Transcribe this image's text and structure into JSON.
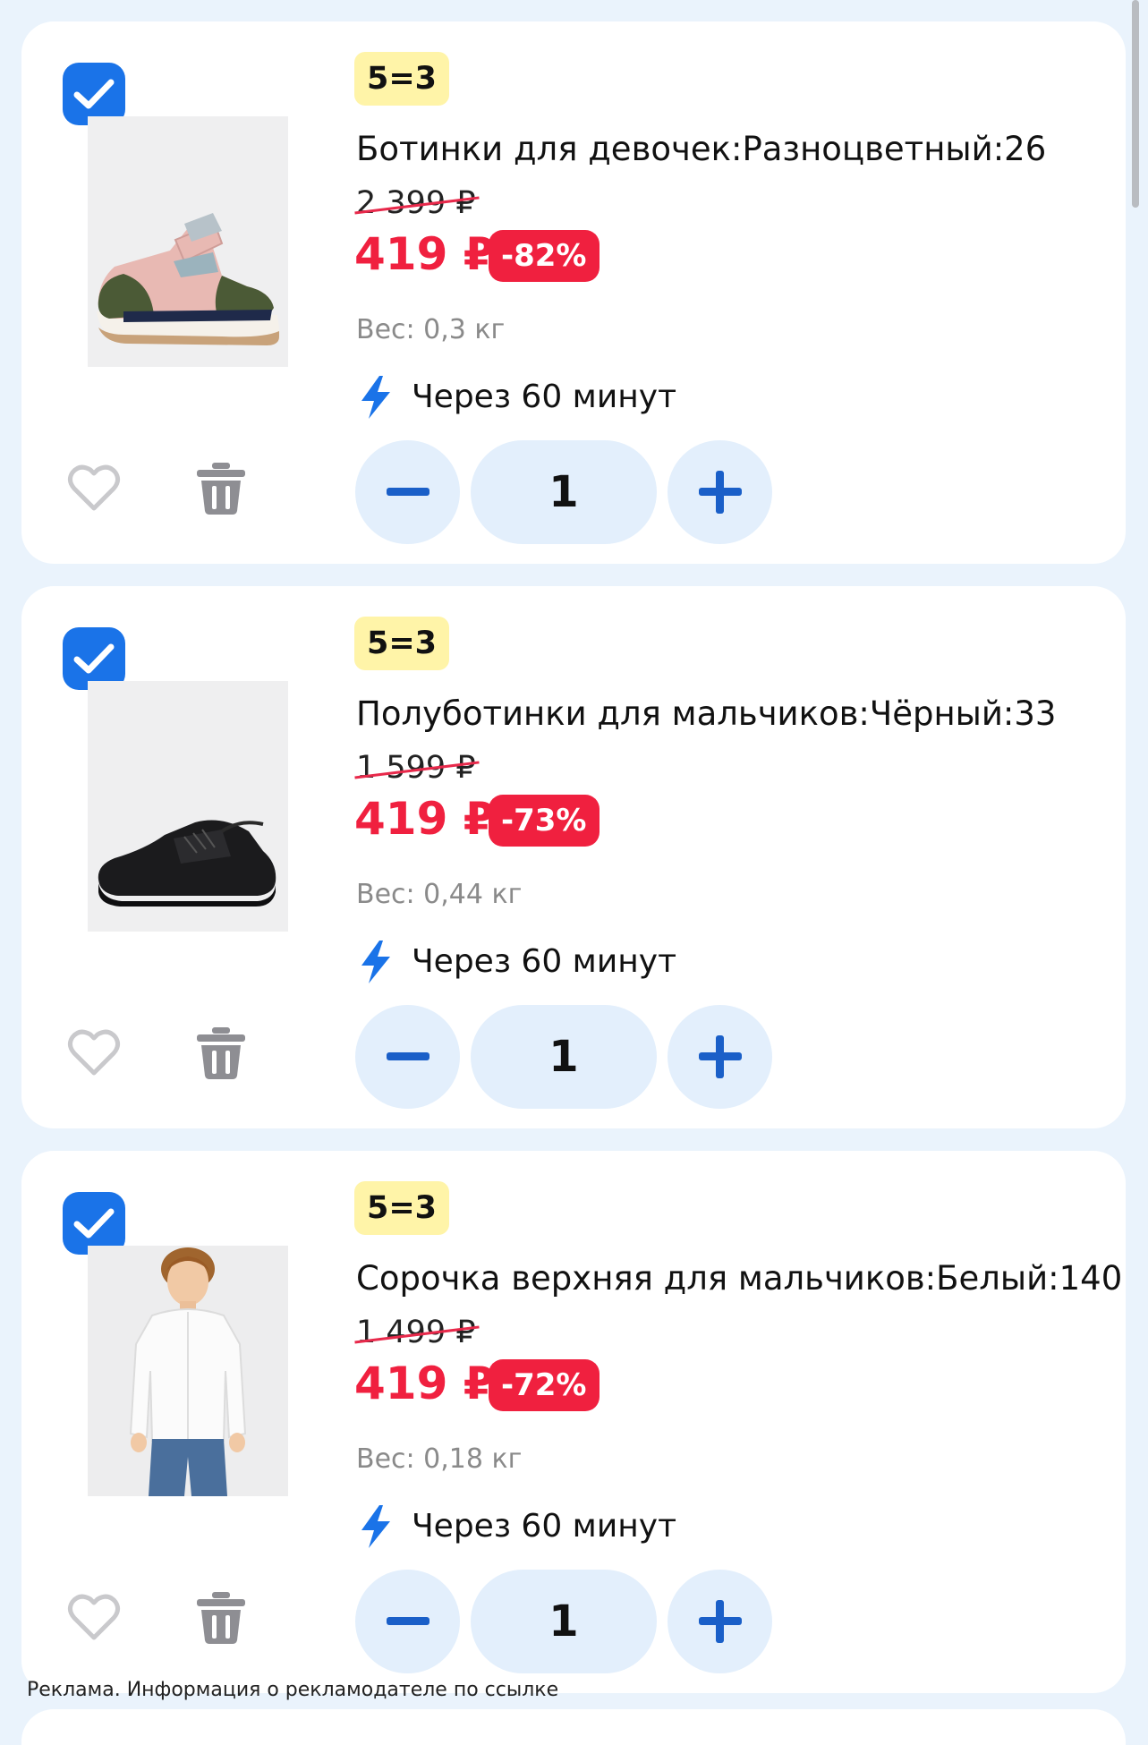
{
  "items": [
    {
      "promo": "5=3",
      "title": "Ботинки для девочек:Разноцветный:26",
      "old_price": "2 399 ₽",
      "price": "419 ₽",
      "discount": "-82%",
      "weight": "Вес: 0,3 кг",
      "delivery": "Через 60 минут",
      "quantity": "1",
      "checked": true,
      "image": "girls-boots"
    },
    {
      "promo": "5=3",
      "title": "Полуботинки для мальчиков:Чёрный:33",
      "old_price": "1 599 ₽",
      "price": "419 ₽",
      "discount": "-73%",
      "weight": "Вес: 0,44 кг",
      "delivery": "Через 60 минут",
      "quantity": "1",
      "checked": true,
      "image": "boys-black-sneakers"
    },
    {
      "promo": "5=3",
      "title": "Сорочка верхняя для мальчиков:Белый:140",
      "old_price": "1 499 ₽",
      "price": "419 ₽",
      "discount": "-72%",
      "weight": "Вес: 0,18 кг",
      "delivery": "Через 60 минут",
      "quantity": "1",
      "checked": true,
      "image": "boy-white-shirt"
    }
  ],
  "ad_note": "Реклама. Информация о рекламодателе по ссылке",
  "icons": {
    "checkbox": "checkmark-icon",
    "favorite": "heart-outline-icon",
    "delete": "trash-icon",
    "delivery": "lightning-icon",
    "decrease": "minus-icon",
    "increase": "plus-icon"
  },
  "colors": {
    "accent": "#1a73e8",
    "price": "#f0203f",
    "promo_badge": "#fff4a8",
    "stepper_bg": "#e3effc",
    "page_bg": "#eaf3fc"
  }
}
